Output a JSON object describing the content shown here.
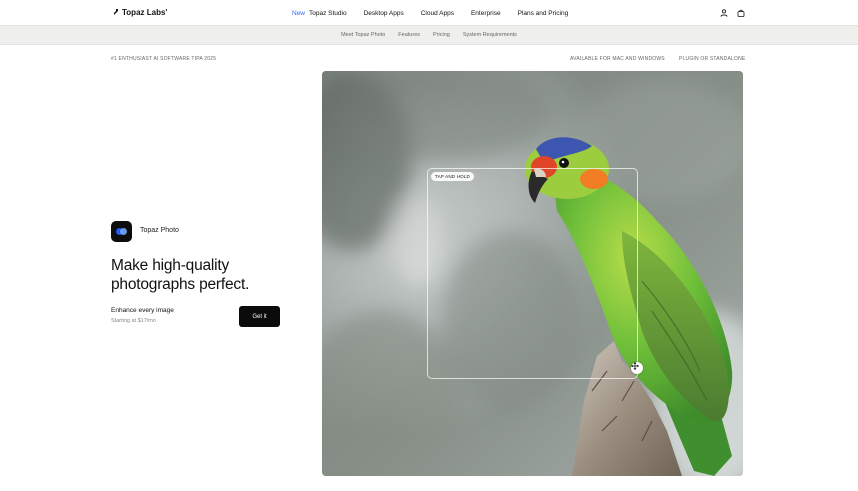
{
  "header": {
    "logo_text": "Topaz Labs'",
    "nav": {
      "new_badge": "New",
      "items": [
        "Topaz Studio",
        "Desktop Apps",
        "Cloud Apps",
        "Enterprise",
        "Plans and Pricing"
      ]
    },
    "icons": [
      "user-icon",
      "bag-icon"
    ]
  },
  "subnav": {
    "items": [
      "Meet Topaz Photo",
      "Features",
      "Pricing",
      "System Requirements"
    ]
  },
  "tags": {
    "left": "#1 ENTHUSIAST AI SOFTWARE TIPA 2025",
    "right_1": "AVAILABLE FOR MAC AND WINDOWS",
    "right_2": "PLUGIN OR STANDALONE"
  },
  "product": {
    "name": "Topaz Photo",
    "headline": "Make high-quality photographs perfect.",
    "sub_title": "Enhance every image",
    "sub_price": "Starting at $17/mo",
    "cta_label": "Get it"
  },
  "hero": {
    "lens_badge": "TAP AND HOLD"
  },
  "colors": {
    "accent": "#2f6bff",
    "cta_bg": "#0b0b0b",
    "subbar_bg": "#efefee"
  }
}
